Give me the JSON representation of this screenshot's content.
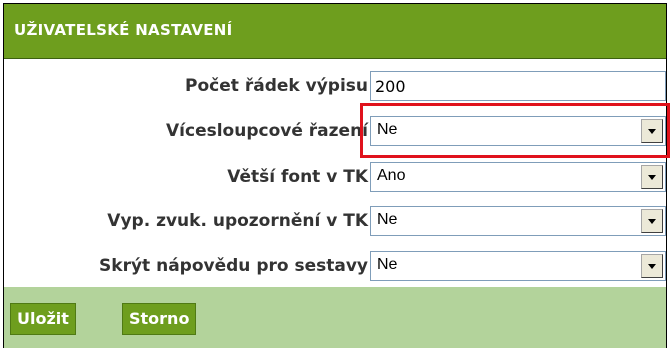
{
  "panel": {
    "title": "UŽIVATELSKÉ NASTAVENÍ",
    "accent_color": "#6e9e1e",
    "footer_color": "#b3d39b",
    "highlight_color": "#e0121c"
  },
  "fields": {
    "rows_count": {
      "label": "Počet řádek výpisu",
      "value": "200"
    },
    "multi_sort": {
      "label": "Vícesloupcové řazení",
      "value": "Ne"
    },
    "bigger_font": {
      "label": "Větší font v TK",
      "value": "Ano"
    },
    "sound_alert": {
      "label": "Vyp. zvuk. upozornění v TK",
      "value": "Ne"
    },
    "hide_help": {
      "label": "Skrýt nápovědu pro sestavy",
      "value": "Ne"
    }
  },
  "buttons": {
    "save": "Uložit",
    "cancel": "Storno"
  },
  "icons": {
    "dropdown": "chevron-down-icon"
  }
}
